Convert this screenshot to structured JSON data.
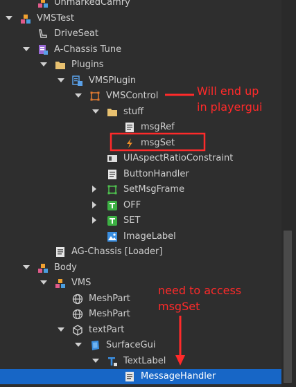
{
  "explorer": {
    "items": [
      {
        "label": "UnmarkedCamry",
        "icon": "model-icon",
        "depth": 1,
        "arrow": "none"
      },
      {
        "label": "VMSTest",
        "icon": "model-icon",
        "depth": 0,
        "arrow": "down"
      },
      {
        "label": "DriveSeat",
        "icon": "seat-icon",
        "depth": 1,
        "arrow": "none"
      },
      {
        "label": "A-Chassis Tune",
        "icon": "module-script-icon",
        "depth": 1,
        "arrow": "down"
      },
      {
        "label": "Plugins",
        "icon": "folder-icon",
        "depth": 2,
        "arrow": "down"
      },
      {
        "label": "VMSPlugin",
        "icon": "plugin-gui-icon",
        "depth": 3,
        "arrow": "down"
      },
      {
        "label": "VMSControl",
        "icon": "frame-icon",
        "depth": 4,
        "arrow": "down"
      },
      {
        "label": "stuff",
        "icon": "folder-icon",
        "depth": 5,
        "arrow": "down"
      },
      {
        "label": "msgRef",
        "icon": "script-icon",
        "depth": 6,
        "arrow": "none"
      },
      {
        "label": "msgSet",
        "icon": "event-icon",
        "depth": 6,
        "arrow": "none"
      },
      {
        "label": "UIAspectRatioConstraint",
        "icon": "constraint-icon",
        "depth": 5,
        "arrow": "none"
      },
      {
        "label": "ButtonHandler",
        "icon": "script-icon",
        "depth": 5,
        "arrow": "none"
      },
      {
        "label": "SetMsgFrame",
        "icon": "frame-green-icon",
        "depth": 5,
        "arrow": "right"
      },
      {
        "label": "OFF",
        "icon": "text-button-icon",
        "depth": 5,
        "arrow": "right"
      },
      {
        "label": "SET",
        "icon": "text-button-icon",
        "depth": 5,
        "arrow": "right"
      },
      {
        "label": "ImageLabel",
        "icon": "image-label-icon",
        "depth": 5,
        "arrow": "none"
      },
      {
        "label": "AG-Chassis [Loader]",
        "icon": "script-icon",
        "depth": 2,
        "arrow": "none"
      },
      {
        "label": "Body",
        "icon": "model-icon",
        "depth": 1,
        "arrow": "down"
      },
      {
        "label": "VMS",
        "icon": "model-icon",
        "depth": 2,
        "arrow": "down"
      },
      {
        "label": "MeshPart",
        "icon": "mesh-icon",
        "depth": 3,
        "arrow": "none"
      },
      {
        "label": "MeshPart",
        "icon": "mesh-icon",
        "depth": 3,
        "arrow": "none"
      },
      {
        "label": "textPart",
        "icon": "part-icon",
        "depth": 3,
        "arrow": "down"
      },
      {
        "label": "SurfaceGui",
        "icon": "surface-gui-icon",
        "depth": 4,
        "arrow": "down"
      },
      {
        "label": "TextLabel",
        "icon": "text-label-icon",
        "depth": 5,
        "arrow": "down"
      },
      {
        "label": "MessageHandler",
        "icon": "script-icon",
        "depth": 6,
        "arrow": "none",
        "selected": true
      }
    ]
  },
  "annotations": {
    "note1_line1": "Will end up",
    "note1_line2": "in playergui",
    "note2_line1": "need to access",
    "note2_line2": "msgSet"
  },
  "colors": {
    "background": "#2e2e2e",
    "selected": "#1766c6",
    "annotation": "#ff2a2a"
  }
}
